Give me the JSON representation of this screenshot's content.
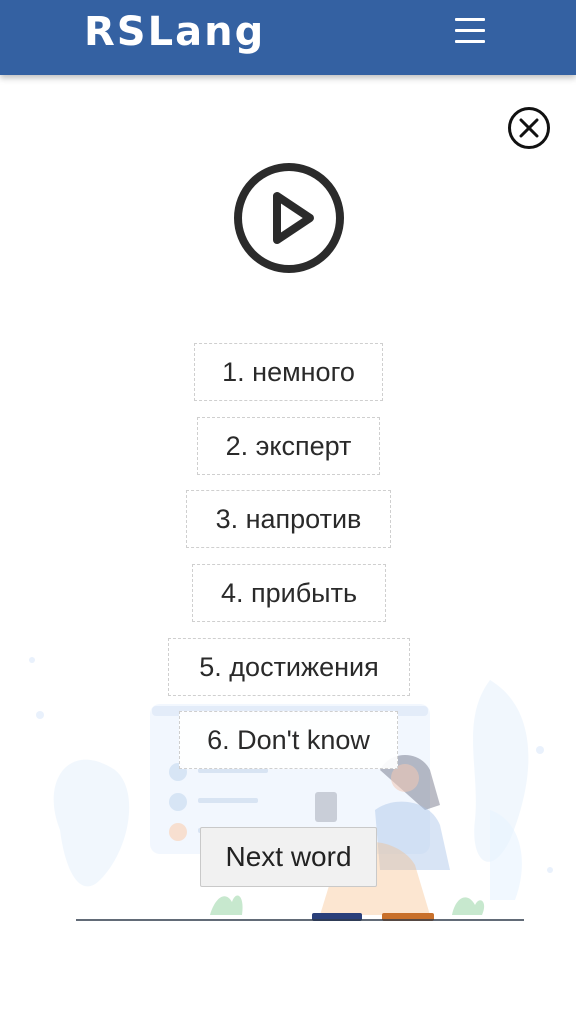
{
  "header": {
    "logo": "RSLang",
    "menu_icon": "hamburger-menu-icon",
    "background_color": "#3461a2"
  },
  "game": {
    "close_icon": "close-circle-icon",
    "play_icon": "play-circle-icon",
    "answers": [
      "1. немного",
      "2. эксперт",
      "3. напротив",
      "4. прибыть",
      "5. достижения",
      "6. Don't know"
    ],
    "next_button": "Next word"
  }
}
